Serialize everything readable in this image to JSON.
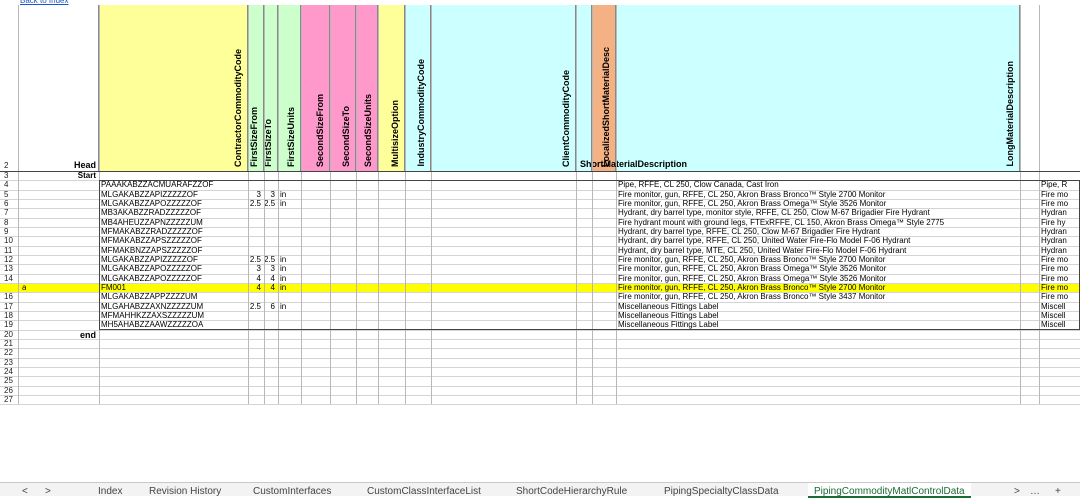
{
  "top_link": "Back to Index",
  "row_numbers": [
    "2",
    "3",
    "4",
    "5",
    "6",
    "7",
    "8",
    "9",
    "10",
    "11",
    "12",
    "13",
    "14",
    "15",
    "16",
    "17",
    "18",
    "19",
    "20",
    "21",
    "22",
    "23",
    "24",
    "25",
    "26",
    "27"
  ],
  "markers": {
    "head": "Head",
    "start": "Start",
    "end": "end",
    "row15_a": "a"
  },
  "columns": [
    {
      "name": "ContractorCommodityCode",
      "color": "#ffff99"
    },
    {
      "name": "FirstSizeFrom",
      "color": "#ccffcc"
    },
    {
      "name": "FirstSizeTo",
      "color": "#ccffcc"
    },
    {
      "name": "FirstSizeUnits",
      "color": "#ccffcc"
    },
    {
      "name": "SecondSizeFrom",
      "color": "#ff99cc"
    },
    {
      "name": "SecondSizeTo",
      "color": "#ff99cc"
    },
    {
      "name": "SecondSizeUnits",
      "color": "#ff99cc"
    },
    {
      "name": "MultisizeOption",
      "color": "#ffff99"
    },
    {
      "name": "IndustryCommodityCode",
      "color": "#ccffff"
    },
    {
      "name": "ClientCommodityCode",
      "color": "#ccffff"
    },
    {
      "name": "ShortMaterialDescription",
      "color": "#ccffff"
    },
    {
      "name": "LocalizedShortMaterialDesc",
      "color": "#f4b183"
    },
    {
      "name": "LongMaterialDescription",
      "color": "#ccffff"
    }
  ],
  "rows": [
    {
      "code": "PAAAKABZZACMUARAFZZOF",
      "from": "",
      "to": "",
      "units": "",
      "desc": "Pipe, RFFE, CL 250, Clow Canada, Cast Iron",
      "long": "Pipe, R"
    },
    {
      "code": "MLGAKABZZAPIZZZZZOF",
      "from": "3",
      "to": "3",
      "units": "in",
      "desc": "Fire monitor, gun, RFFE, CL 250, Akron Brass Bronco™ Style 2700 Monitor",
      "long": "Fire mo"
    },
    {
      "code": "MLGAKABZZAPOZZZZZOF",
      "from": "2.5",
      "to": "2.5",
      "units": "in",
      "desc": "Fire monitor, gun, RFFE, CL 250, Akron Brass Omega™ Style 3526 Monitor",
      "long": "Fire mo"
    },
    {
      "code": "MB3AKABZZRADZZZZZOF",
      "from": "",
      "to": "",
      "units": "",
      "desc": "Hydrant, dry barrel type, monitor style, RFFE, CL 250, Clow M-67 Brigadier Fire Hydrant",
      "long": "Hydran"
    },
    {
      "code": "MB4AHEUZZAPNZZZZZUM",
      "from": "",
      "to": "",
      "units": "",
      "desc": "Fire hydrant mount with ground legs, FTExRFFE, CL 150, Akron Brass Omega™ Style 2775",
      "long": "Fire hy"
    },
    {
      "code": "MFMAKABZZRADZZZZZOF",
      "from": "",
      "to": "",
      "units": "",
      "desc": "Hydrant, dry barrel type, RFFE, CL 250, Clow M-67 Brigadier Fire Hydrant",
      "long": "Hydran"
    },
    {
      "code": "MFMAKABZZAPSZZZZZOF",
      "from": "",
      "to": "",
      "units": "",
      "desc": "Hydrant, dry barrel type, RFFE, CL 250, United Water Fire-Flo Model F-06 Hydrant",
      "long": "Hydran"
    },
    {
      "code": "MFMAKBNZZAPSZZZZZOF",
      "from": "",
      "to": "",
      "units": "",
      "desc": "Hydrant, dry barrel type, MTE, CL 250, United Water Fire-Flo Model F-06 Hydrant",
      "long": "Hydran"
    },
    {
      "code": "MLGAKABZZAPIZZZZZOF",
      "from": "2.5",
      "to": "2.5",
      "units": "in",
      "desc": "Fire monitor, gun, RFFE, CL 250, Akron Brass Bronco™ Style 2700 Monitor",
      "long": "Fire mo"
    },
    {
      "code": "MLGAKABZZAPOZZZZZOF",
      "from": "3",
      "to": "3",
      "units": "in",
      "desc": "Fire monitor, gun, RFFE, CL 250, Akron Brass Omega™ Style 3526 Monitor",
      "long": "Fire mo"
    },
    {
      "code": "MLGAKABZZAPOZZZZZOF",
      "from": "4",
      "to": "4",
      "units": "in",
      "desc": "Fire monitor, gun, RFFE, CL 250, Akron Brass Omega™ Style 3526 Monitor",
      "long": "Fire mo"
    },
    {
      "code": "FM001",
      "from": "4",
      "to": "4",
      "units": "in",
      "desc": "Fire monitor, gun, RFFE, CL 250, Akron Brass Bronco™ Style 2700 Monitor",
      "long": "Fire mo",
      "highlight": true
    },
    {
      "code": "MLGAKABZZAPPZZZZUM",
      "from": "",
      "to": "",
      "units": "",
      "desc": "Fire monitor, gun, RFFE, CL 250, Akron Brass Bronco™ Style 3437 Monitor",
      "long": "Fire mo"
    },
    {
      "code": "MLGAHABZZAXNZZZZZUM",
      "from": "2.5",
      "to": "6",
      "units": "in",
      "desc": "Miscellaneous Fittings Label",
      "long": "Miscell"
    },
    {
      "code": "MFMAHHKZZAXSZZZZZUM",
      "from": "",
      "to": "",
      "units": "",
      "desc": "Miscellaneous Fittings Label",
      "long": "Miscell"
    },
    {
      "code": "MH5AHABZZAAWZZZZZOA",
      "from": "",
      "to": "",
      "units": "",
      "desc": "Miscellaneous Fittings Label",
      "long": "Miscell"
    }
  ],
  "highlight_color": "#ffff00",
  "tabs": [
    "Index",
    "Revision History",
    "CustomInterfaces",
    "CustomClassInterfaceList",
    "ShortCodeHierarchyRule",
    "PipingSpecialtyClassData",
    "PipingCommodityMatlControlData"
  ],
  "active_tab": "PipingCommodityMatlControlData",
  "tab_nav": {
    "prev": "<",
    "next": ">",
    "more": "…",
    "add": "+"
  }
}
